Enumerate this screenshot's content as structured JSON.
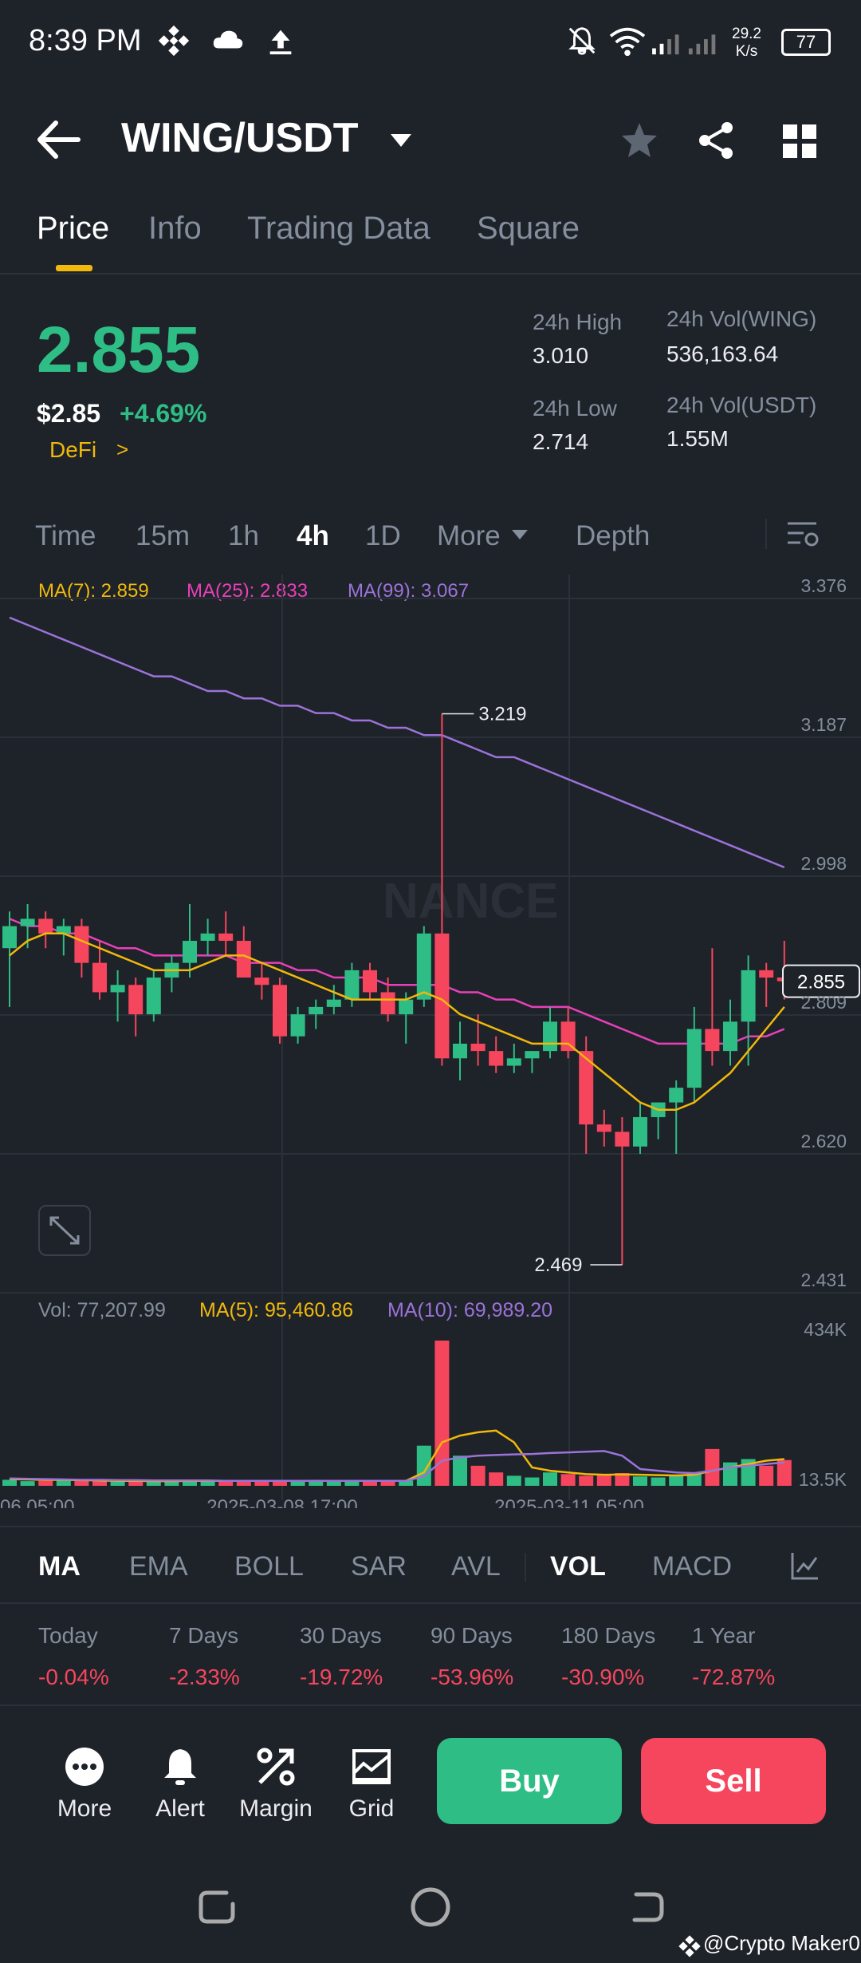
{
  "status_bar": {
    "time": "8:39 PM",
    "net_speed_value": "29.2",
    "net_speed_unit": "K/s",
    "battery": "77"
  },
  "header": {
    "pair": "WING/USDT"
  },
  "tabs": [
    {
      "label": "Price"
    },
    {
      "label": "Info"
    },
    {
      "label": "Trading Data"
    },
    {
      "label": "Square"
    }
  ],
  "price": {
    "last": "2.855",
    "usd": "$2.85",
    "change": "+4.69%",
    "tag": "DeFi",
    "tag_arrow": ">"
  },
  "stats": {
    "high_label": "24h High",
    "high_value": "3.010",
    "low_label": "24h Low",
    "low_value": "2.714",
    "vol_base_label": "24h Vol(WING)",
    "vol_base_value": "536,163.64",
    "vol_quote_label": "24h Vol(USDT)",
    "vol_quote_value": "1.55M"
  },
  "intervals": [
    "Time",
    "15m",
    "1h",
    "4h",
    "1D",
    "More",
    "Depth"
  ],
  "ma_legend": {
    "ma7": "MA(7): 2.859",
    "ma25": "MA(25): 2.833",
    "ma99": "MA(99): 3.067"
  },
  "vol_legend": {
    "vol": "Vol: 77,207.99",
    "ma5": "MA(5): 95,460.86",
    "ma10": "MA(10): 69,989.20"
  },
  "watermark_text": "NANCE",
  "chart_data": {
    "type": "candlestick",
    "price_axis": [
      "3.376",
      "3.187",
      "2.998",
      "2.809",
      "2.620",
      "2.431"
    ],
    "ylim": [
      2.431,
      3.376
    ],
    "current_price": "2.855",
    "annotations": {
      "high": "3.219",
      "low": "2.469"
    },
    "volume_axis": [
      "434K",
      "13.5K"
    ],
    "time_axis": [
      "06 05:00",
      "2025-03-08 17:00",
      "2025-03-11 05:00"
    ],
    "colors": {
      "up": "#2ebd85",
      "down": "#f6465d",
      "ma7": "#f0b90b",
      "ma25": "#e840b9",
      "ma99": "#9b73d9"
    },
    "candles": [
      [
        2.9,
        2.95,
        2.82,
        2.93
      ],
      [
        2.93,
        2.96,
        2.9,
        2.94
      ],
      [
        2.94,
        2.95,
        2.9,
        2.92
      ],
      [
        2.92,
        2.94,
        2.89,
        2.93
      ],
      [
        2.93,
        2.94,
        2.86,
        2.88
      ],
      [
        2.88,
        2.91,
        2.83,
        2.84
      ],
      [
        2.84,
        2.87,
        2.8,
        2.85
      ],
      [
        2.85,
        2.86,
        2.78,
        2.81
      ],
      [
        2.81,
        2.87,
        2.8,
        2.86
      ],
      [
        2.86,
        2.89,
        2.84,
        2.88
      ],
      [
        2.88,
        2.96,
        2.86,
        2.91
      ],
      [
        2.91,
        2.94,
        2.89,
        2.92
      ],
      [
        2.92,
        2.95,
        2.89,
        2.91
      ],
      [
        2.91,
        2.93,
        2.86,
        2.86
      ],
      [
        2.86,
        2.88,
        2.83,
        2.85
      ],
      [
        2.85,
        2.86,
        2.77,
        2.78
      ],
      [
        2.78,
        2.82,
        2.77,
        2.81
      ],
      [
        2.81,
        2.83,
        2.79,
        2.82
      ],
      [
        2.82,
        2.85,
        2.81,
        2.83
      ],
      [
        2.83,
        2.88,
        2.82,
        2.87
      ],
      [
        2.87,
        2.88,
        2.83,
        2.84
      ],
      [
        2.84,
        2.86,
        2.8,
        2.81
      ],
      [
        2.81,
        2.84,
        2.77,
        2.83
      ],
      [
        2.83,
        2.93,
        2.82,
        2.92
      ],
      [
        2.92,
        3.219,
        2.74,
        2.75
      ],
      [
        2.75,
        2.8,
        2.72,
        2.77
      ],
      [
        2.77,
        2.81,
        2.74,
        2.76
      ],
      [
        2.76,
        2.78,
        2.73,
        2.74
      ],
      [
        2.74,
        2.77,
        2.73,
        2.75
      ],
      [
        2.75,
        2.76,
        2.73,
        2.76
      ],
      [
        2.76,
        2.82,
        2.75,
        2.8
      ],
      [
        2.8,
        2.82,
        2.75,
        2.76
      ],
      [
        2.76,
        2.78,
        2.62,
        2.66
      ],
      [
        2.66,
        2.68,
        2.63,
        2.65
      ],
      [
        2.65,
        2.67,
        2.469,
        2.63
      ],
      [
        2.63,
        2.69,
        2.62,
        2.67
      ],
      [
        2.67,
        2.69,
        2.64,
        2.69
      ],
      [
        2.69,
        2.72,
        2.62,
        2.71
      ],
      [
        2.71,
        2.82,
        2.69,
        2.79
      ],
      [
        2.79,
        2.9,
        2.74,
        2.76
      ],
      [
        2.76,
        2.83,
        2.74,
        2.8
      ],
      [
        2.8,
        2.89,
        2.74,
        2.87
      ],
      [
        2.87,
        2.88,
        2.82,
        2.86
      ],
      [
        2.86,
        2.91,
        2.83,
        2.855
      ]
    ],
    "ma7": [
      2.89,
      2.91,
      2.92,
      2.92,
      2.91,
      2.9,
      2.89,
      2.88,
      2.87,
      2.87,
      2.87,
      2.88,
      2.89,
      2.89,
      2.88,
      2.87,
      2.86,
      2.85,
      2.84,
      2.83,
      2.83,
      2.83,
      2.83,
      2.84,
      2.83,
      2.81,
      2.8,
      2.79,
      2.78,
      2.77,
      2.77,
      2.77,
      2.75,
      2.73,
      2.71,
      2.69,
      2.68,
      2.68,
      2.69,
      2.71,
      2.73,
      2.76,
      2.79,
      2.82
    ],
    "ma25": [
      2.94,
      2.93,
      2.93,
      2.92,
      2.92,
      2.91,
      2.9,
      2.9,
      2.89,
      2.89,
      2.89,
      2.89,
      2.89,
      2.88,
      2.88,
      2.88,
      2.87,
      2.87,
      2.86,
      2.86,
      2.86,
      2.85,
      2.85,
      2.85,
      2.85,
      2.84,
      2.84,
      2.83,
      2.83,
      2.82,
      2.82,
      2.82,
      2.81,
      2.8,
      2.79,
      2.78,
      2.77,
      2.77,
      2.77,
      2.77,
      2.77,
      2.78,
      2.78,
      2.79
    ],
    "ma99": [
      3.35,
      3.34,
      3.33,
      3.32,
      3.31,
      3.3,
      3.29,
      3.28,
      3.27,
      3.27,
      3.26,
      3.25,
      3.25,
      3.24,
      3.24,
      3.23,
      3.23,
      3.22,
      3.22,
      3.21,
      3.21,
      3.2,
      3.2,
      3.19,
      3.19,
      3.18,
      3.17,
      3.16,
      3.16,
      3.15,
      3.14,
      3.13,
      3.12,
      3.11,
      3.1,
      3.09,
      3.08,
      3.07,
      3.06,
      3.05,
      3.04,
      3.03,
      3.02,
      3.01
    ],
    "volumes": [
      18,
      14,
      15,
      20,
      16,
      14,
      12,
      15,
      13,
      14,
      18,
      16,
      14,
      15,
      12,
      14,
      16,
      18,
      15,
      14,
      13,
      14,
      16,
      120,
      434,
      90,
      60,
      40,
      30,
      25,
      40,
      35,
      30,
      32,
      38,
      28,
      25,
      30,
      40,
      110,
      70,
      80,
      60,
      77
    ],
    "vol_ma5": [
      20,
      19,
      18,
      18,
      17,
      16,
      15,
      15,
      14,
      14,
      15,
      15,
      15,
      15,
      15,
      15,
      15,
      15,
      15,
      15,
      15,
      15,
      15,
      40,
      130,
      150,
      160,
      165,
      130,
      55,
      45,
      40,
      35,
      33,
      34,
      33,
      32,
      31,
      33,
      45,
      55,
      65,
      75,
      80
    ],
    "vol_ma10": [
      22,
      21,
      20,
      19,
      18,
      18,
      17,
      17,
      16,
      16,
      16,
      16,
      15,
      15,
      15,
      15,
      15,
      15,
      15,
      15,
      15,
      15,
      15,
      28,
      75,
      85,
      90,
      92,
      94,
      95,
      98,
      100,
      102,
      104,
      90,
      50,
      45,
      40,
      38,
      45,
      55,
      60,
      65,
      70
    ]
  },
  "indicators": [
    "MA",
    "EMA",
    "BOLL",
    "SAR",
    "AVL",
    "VOL",
    "MACD"
  ],
  "performance": [
    {
      "label": "Today",
      "value": "-0.04%"
    },
    {
      "label": "7 Days",
      "value": "-2.33%"
    },
    {
      "label": "30 Days",
      "value": "-19.72%"
    },
    {
      "label": "90 Days",
      "value": "-53.96%"
    },
    {
      "label": "180 Days",
      "value": "-30.90%"
    },
    {
      "label": "1 Year",
      "value": "-72.87%"
    }
  ],
  "actions": {
    "more": "More",
    "alert": "Alert",
    "margin": "Margin",
    "grid": "Grid",
    "buy": "Buy",
    "sell": "Sell"
  },
  "footer": {
    "credit": "@Crypto Maker0"
  }
}
